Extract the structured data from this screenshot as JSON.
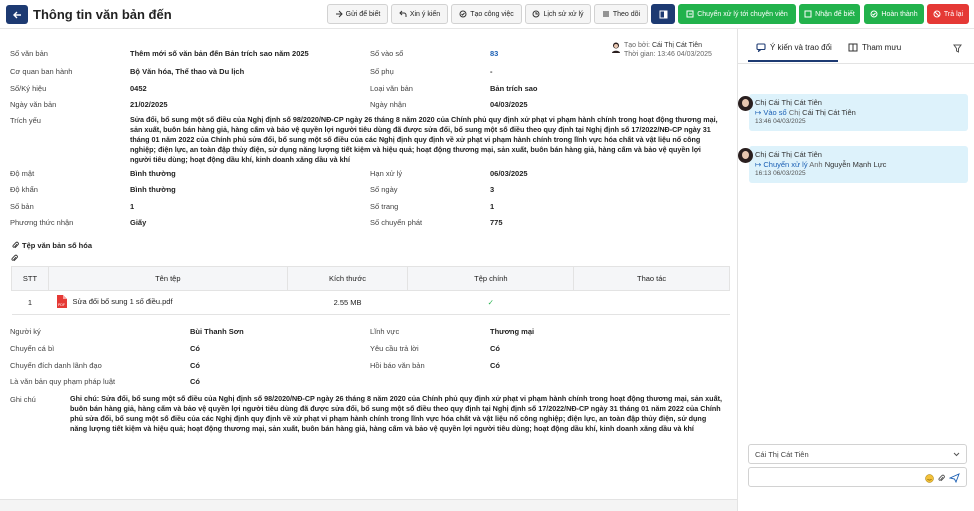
{
  "header": {
    "title": "Thông tin văn bản đến"
  },
  "toolbar": {
    "b1": "Gửi để biết",
    "b2": "Xin ý kiến",
    "b3": "Tạo công việc",
    "b4": "Lịch sử xử lý",
    "b5": "Theo dõi",
    "b7": "Chuyển xử lý tới chuyên viên",
    "b8": "Nhận để biết",
    "b9": "Hoàn thành",
    "b10": "Trả lại"
  },
  "fields": {
    "so_van_ban_lbl": "Số văn bản",
    "so_van_ban": "Thêm mới số văn bản đến Bản trích sao năm 2025",
    "so_vao_so_lbl": "Số vào sổ",
    "so_vao_so": "83",
    "co_quan_lbl": "Cơ quan ban hành",
    "co_quan": "Bộ Văn hóa, Thể thao và Du lịch",
    "so_phu_lbl": "Số phụ",
    "so_phu": "-",
    "ky_hieu_lbl": "Số/Ký hiệu",
    "ky_hieu": "0452",
    "loai_lbl": "Loại văn bản",
    "loai": "Bản trích sao",
    "ngay_vb_lbl": "Ngày văn bản",
    "ngay_vb": "21/02/2025",
    "ngay_nhan_lbl": "Ngày nhận",
    "ngay_nhan": "04/03/2025",
    "trich_yeu_lbl": "Trích yếu",
    "trich_yeu": "Sửa đổi, bổ sung một số điều của Nghị định số 98/2020/NĐ-CP ngày 26 tháng 8 năm 2020 của Chính phủ quy định xử phạt vi phạm hành chính trong hoạt động thương mại, sản xuất, buôn bán hàng giả, hàng cấm và bảo vệ quyền lợi người tiêu dùng đã được sửa đổi, bổ sung một số điều theo quy định tại Nghị định số 17/2022/NĐ-CP ngày 31 tháng 01 năm 2022 của Chính phủ sửa đổi, bổ sung một số điều của các Nghị định quy định về xử phạt vi phạm hành chính trong lĩnh vực hóa chất và vật liệu nổ công nghiệp; điện lực, an toàn đập thủy điện, sử dụng năng lượng tiết kiệm và hiệu quả; hoạt động thương mại, sản xuất, buôn bán hàng giả, hàng cấm và bảo vệ quyền lợi người tiêu dùng; hoạt động dầu khí, kinh doanh xăng dầu và khí",
    "do_mat_lbl": "Độ mật",
    "do_mat": "Bình thường",
    "han_lbl": "Hạn xử lý",
    "han": "06/03/2025",
    "do_khan_lbl": "Độ khẩn",
    "do_khan": "Bình thường",
    "so_ngay_lbl": "Số ngày",
    "so_ngay": "3",
    "so_ban_lbl": "Số bản",
    "so_ban": "1",
    "so_trang_lbl": "Số trang",
    "so_trang": "1",
    "ptn_lbl": "Phương thức nhận",
    "ptn": "Giấy",
    "scp_lbl": "Số chuyển phát",
    "scp": "775",
    "nguoi_ky_lbl": "Người ký",
    "nguoi_ky": "Bùi Thanh Sơn",
    "linh_vuc_lbl": "Lĩnh vực",
    "linh_vuc": "Thương mại",
    "ccb_lbl": "Chuyển cá bì",
    "ccb": "Có",
    "yctl_lbl": "Yêu cầu trả lời",
    "yctl": "Có",
    "cddld_lbl": "Chuyển đích danh lãnh đạo",
    "cddld": "Có",
    "hbvb_lbl": "Hồi báo văn bản",
    "hbvb": "Có",
    "qppl_lbl": "Là văn bản quy phạm pháp luật",
    "qppl": "Có",
    "ghi_chu_lbl": "Ghi chú",
    "ghi_chu": "Ghi chú: Sửa đổi, bổ sung một số điều của Nghị định số 98/2020/NĐ-CP ngày 26 tháng 8 năm 2020 của Chính phủ quy định xử phạt vi phạm hành chính trong hoạt động thương mại, sản xuất, buôn bán hàng giả, hàng cấm và bảo vệ quyền lợi người tiêu dùng đã được sửa đổi, bổ sung một số điều theo quy định tại Nghị định số 17/2022/NĐ-CP ngày 31 tháng 01 năm 2022 của Chính phủ sửa đổi, bổ sung một số điều của các Nghị định quy định về xử phạt vi phạm hành chính trong lĩnh vực hóa chất và vật liệu nổ công nghiệp; điện lực, an toàn đập thủy điện, sử dụng năng lượng tiết kiệm và hiệu quả; hoạt động thương mại, sản xuất, buôn bán hàng giả, hàng cấm và bảo vệ quyền lợi người tiêu dùng; hoạt động dầu khí, kinh doanh xăng dầu và khí"
  },
  "creator": {
    "line1": "Tạo bởi: ",
    "name": "Cái Thị Cát Tiên",
    "line2": "Thời gian: 13:46 04/03/2025"
  },
  "files": {
    "title": "Tệp văn bản số hóa",
    "headers": [
      "STT",
      "Tên tệp",
      "Kích thước",
      "Tệp chính",
      "Thao tác"
    ],
    "row": {
      "stt": "1",
      "name": "Sửa đổi bổ sung 1 số điều.pdf",
      "size": "2.55 MB",
      "main": "✓"
    }
  },
  "sidebar": {
    "tab1": "Ý kiến và trao đổi",
    "tab2": "Tham mưu",
    "c1": {
      "pre": "Chị ",
      "name": "Cái Thị Cát Tiên",
      "arrow": "↦ ",
      "action": "Vào sổ",
      "sep": "  Chị ",
      "target": "Cái Thị Cát Tiên",
      "time": "13:46 04/03/2025"
    },
    "c2": {
      "pre": "Chị ",
      "name": "Cái Thị Cát Tiên",
      "arrow": "↦ ",
      "action": "Chuyển xử lý",
      "sep": "  Anh ",
      "target": "Nguyễn Mạnh Lực",
      "time": "16:13 06/03/2025"
    },
    "select": "Cái Thị Cát Tiên",
    "input_placeholder": ""
  }
}
